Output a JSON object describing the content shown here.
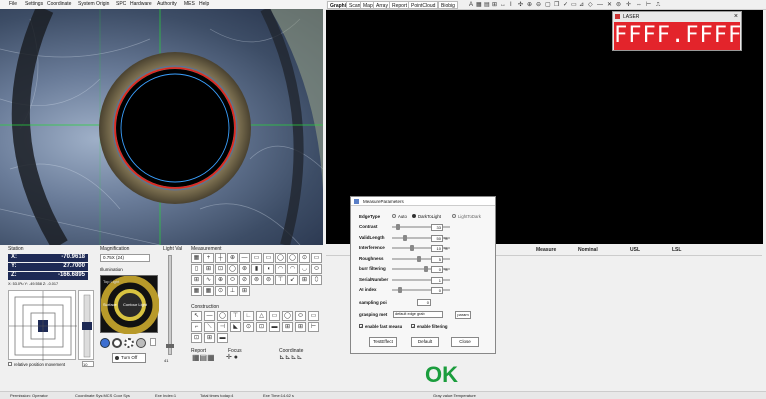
{
  "menu": [
    "File",
    "Settings",
    "Coordinate",
    "System Origin",
    "SPC",
    "Hardware",
    "Authority",
    "MES",
    "Help"
  ],
  "graphic_tabs": [
    "Graphic",
    "Scan",
    "Map",
    "Array",
    "Report",
    "PointCloud",
    "Biobig"
  ],
  "laser": {
    "title": "LASER",
    "value": "FFFF.FFFF",
    "close": "×",
    "color": "#e3242b"
  },
  "station": {
    "title": "Station",
    "x_label": "X:",
    "x_value": "-70.9618",
    "y_label": "Y:",
    "y_value": "27.7000",
    "z_label": "Z:",
    "z_value": "-166.6895",
    "small_readout": "X: 53.0ºu  Y: -49.558  Z: -0.017",
    "relative_label": "relative position movement",
    "relative_value": "10"
  },
  "magnification": {
    "title": "Magnification",
    "value": "0.75X (24)",
    "illumination_title": "Illumination",
    "top_light": "Top Light",
    "surface_label": "Surface",
    "contour_label": "Contour Light",
    "turn_off": "Turn Off",
    "light_val_label": "Light Val",
    "light_val": "41"
  },
  "measurement": {
    "title": "Measurement",
    "construction_title": "Construction",
    "report_title": "Report",
    "focus_title": "Focus",
    "coordinate_title": "Coordinate"
  },
  "result_table": {
    "headers": [
      "Measure",
      "Nominal",
      "USL",
      "LSL"
    ]
  },
  "dialog": {
    "title": "MeasureParameters",
    "edge_type_label": "EdgeType",
    "edge_options": [
      "Auto",
      "DarkToLight",
      "LightToDark"
    ],
    "edge_selected": "DarkToLight",
    "rows": [
      {
        "label": "Contrast",
        "value": "33",
        "unit": ""
      },
      {
        "label": "ValidLength",
        "value": "50",
        "unit": "%"
      },
      {
        "label": "Interference",
        "value": "10",
        "unit": "%"
      },
      {
        "label": "Roughness",
        "value": "5",
        "unit": ""
      },
      {
        "label": "burr filtering",
        "value": "0",
        "unit": "%"
      },
      {
        "label": "SerialNumber",
        "value": "1",
        "unit": ""
      },
      {
        "label": "AI index",
        "value": "0",
        "unit": ""
      }
    ],
    "sampling_label": "sampling poi",
    "sampling_value": "0",
    "grasping_label": "grasping met",
    "grasping_value": "default edge grab",
    "grasping_button": "param",
    "fast_measure": "enable fast measu",
    "filtering": "enable filtering",
    "buttons": [
      "TestEffect",
      "Default",
      "Close"
    ]
  },
  "status_text": "OK",
  "status_color": "#1b9d3d",
  "statusbar": {
    "permission": "Permission: Operator",
    "coord": "Coordinate Sys:MCS Coor Sys",
    "exe_index": "Exe Index:1",
    "total": "Total times today:4",
    "exe_time": "Exe Time:14.62 s",
    "gray": "Gray value:Temperature"
  }
}
